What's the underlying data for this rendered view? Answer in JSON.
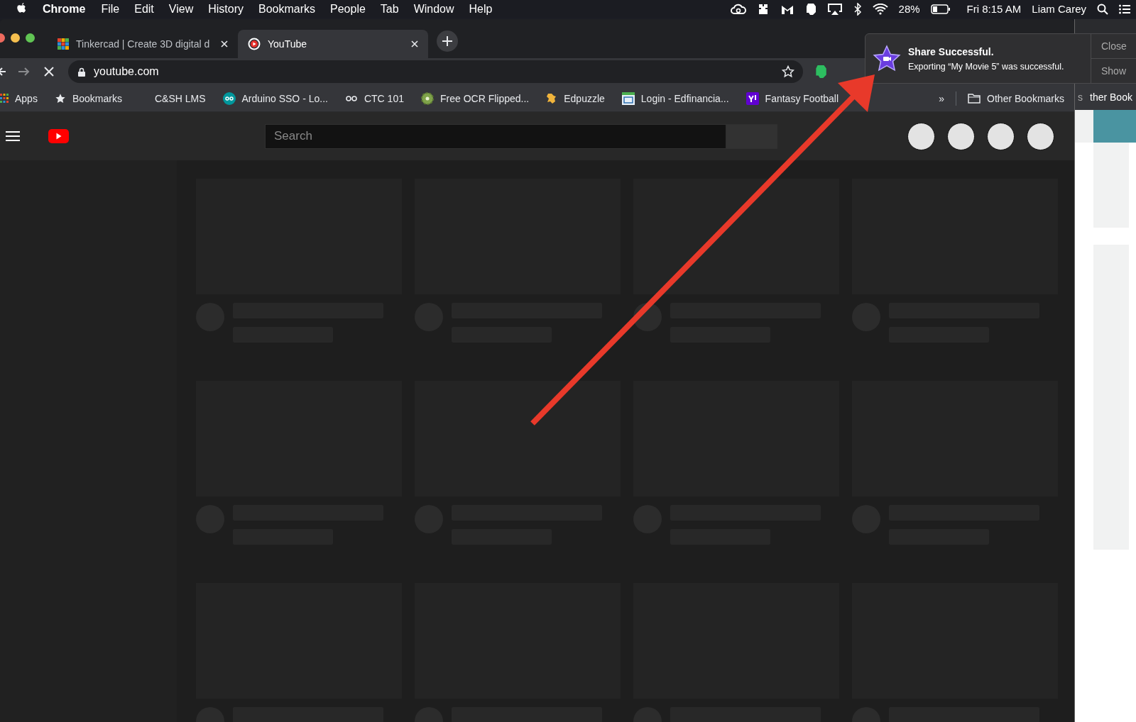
{
  "menubar": {
    "app_name": "Chrome",
    "menus": [
      "File",
      "Edit",
      "View",
      "History",
      "Bookmarks",
      "People",
      "Tab",
      "Window",
      "Help"
    ],
    "battery": "28%",
    "clock": "Fri 8:15 AM",
    "user": "Liam Carey"
  },
  "tabs": [
    {
      "title": "Tinkercad | Create 3D digital d",
      "selected": false
    },
    {
      "title": "YouTube",
      "selected": true
    }
  ],
  "toolbar": {
    "address": "youtube.com"
  },
  "bookmarks": [
    {
      "label": "Apps"
    },
    {
      "label": "Bookmarks"
    },
    {
      "label": "C&SH LMS"
    },
    {
      "label": "Arduino SSO - Lo..."
    },
    {
      "label": "CTC 101"
    },
    {
      "label": "Free OCR Flipped..."
    },
    {
      "label": "Edpuzzle"
    },
    {
      "label": "Login - Edfinancia..."
    },
    {
      "label": "Fantasy Football"
    }
  ],
  "bookmarks_overflow": "»",
  "other_bookmarks": "Other Bookmarks",
  "youtube": {
    "search": {
      "placeholder": "Search"
    }
  },
  "notification": {
    "title": "Share Successful.",
    "message": "Exporting “My Movie 5” was successful.",
    "buttons": [
      "Close",
      "Show"
    ]
  },
  "background_window": {
    "texts": [
      "s",
      "ther Book"
    ]
  }
}
